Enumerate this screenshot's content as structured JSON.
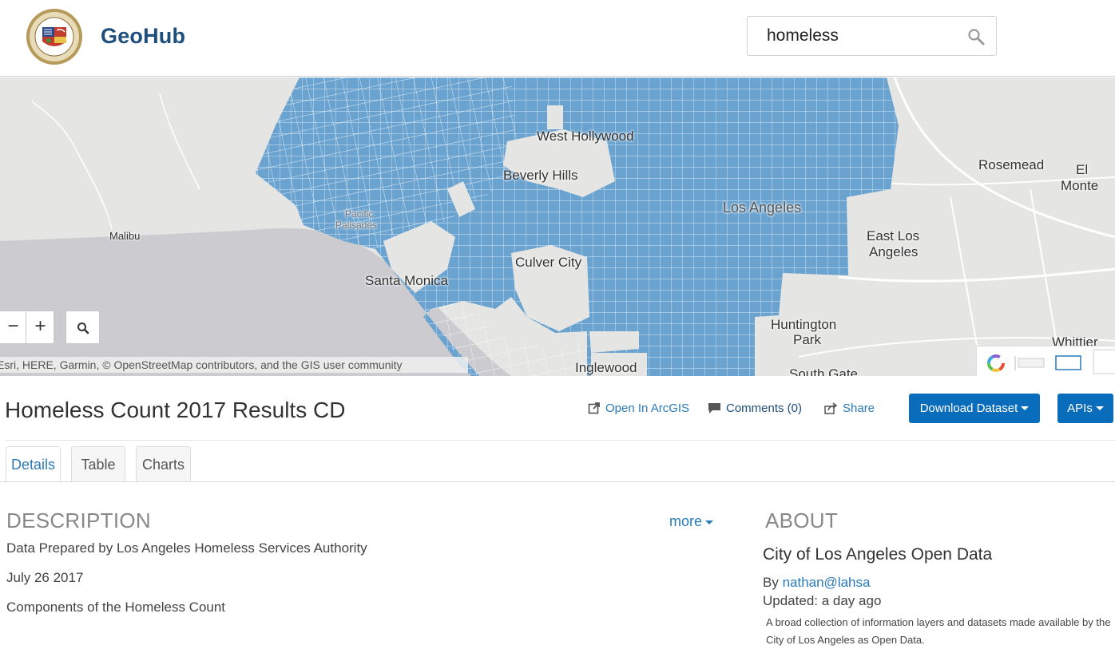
{
  "header": {
    "brand": "GeoHub",
    "search_value": "homeless",
    "seal_icon": "city-seal-icon"
  },
  "map": {
    "labels": {
      "west_hollywood": "West Hollywood",
      "beverly_hills": "Beverly Hills",
      "pacific_palisades_1": "Pacific",
      "pacific_palisades_2": "Palisades",
      "los_angeles": "Los Angeles",
      "malibu": "Malibu",
      "santa_monica": "Santa Monica",
      "culver_city": "Culver City",
      "rosemead": "Rosemead",
      "el_monte_1": "El",
      "el_monte_2": "Monte",
      "east_la_1": "East Los",
      "east_la_2": "Angeles",
      "huntington_1": "Huntington",
      "huntington_2": "Park",
      "inglewood": "Inglewood",
      "whittier": "Whittier",
      "south_gate": "South Gate"
    },
    "zoom_out": "−",
    "zoom_in": "+",
    "attribution": "Esri, HERE, Garmin, © OpenStreetMap contributors, and the GIS user community",
    "fill_color": "#6aa3d0",
    "line_color": "#ffffff"
  },
  "dataset": {
    "title": "Homeless Count 2017 Results CD",
    "open_in_arcgis": "Open In ArcGIS",
    "comments": "Comments (0)",
    "share": "Share",
    "download": "Download Dataset",
    "apis": "APIs"
  },
  "tabs": [
    "Details",
    "Table",
    "Charts"
  ],
  "description": {
    "heading": "DESCRIPTION",
    "more": "more",
    "lines": [
      "Data Prepared by Los Angeles Homeless Services Authority",
      "July 26 2017",
      "Components of the Homeless Count"
    ]
  },
  "about": {
    "heading": "ABOUT",
    "org": "City of Los Angeles Open Data",
    "by_prefix": "By ",
    "by_user": "nathan@lahsa",
    "updated": "Updated: a day ago",
    "text": "A broad collection of information layers and datasets made available by the City of Los Angeles as Open Data."
  },
  "colors": {
    "accent": "#2a7ab8",
    "brand": "#1d4e7c",
    "button": "#0a6dbc"
  }
}
